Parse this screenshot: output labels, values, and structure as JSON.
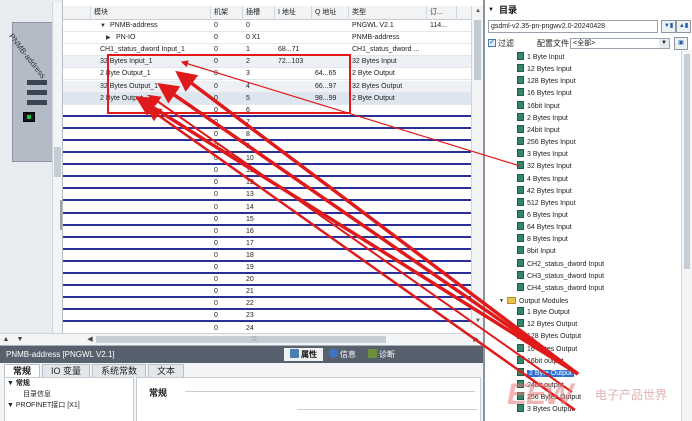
{
  "device_view": {
    "device_label": "PNMB-address"
  },
  "table": {
    "headers": [
      "",
      "模块",
      "机架",
      "插槽",
      "I 地址",
      "Q 地址",
      "类型",
      "订..."
    ],
    "rows": [
      {
        "indent": 1,
        "arrow": "▼",
        "module": "PNMB-address",
        "rack": "0",
        "slot": "0",
        "i_addr": "",
        "q_addr": "",
        "type": "PNGWL V2.1",
        "order": "114..."
      },
      {
        "indent": 2,
        "arrow": "▶",
        "module": "PN-IO",
        "rack": "0",
        "slot": "0 X1",
        "i_addr": "",
        "q_addr": "",
        "type": "PNMB-address",
        "order": ""
      },
      {
        "indent": 1,
        "arrow": "",
        "module": "CH1_status_dword Input_1",
        "rack": "0",
        "slot": "1",
        "i_addr": "68...71",
        "q_addr": "",
        "type": "CH1_status_dword ...",
        "order": ""
      },
      {
        "indent": 1,
        "arrow": "",
        "module": "32 Bytes Input_1",
        "rack": "0",
        "slot": "2",
        "i_addr": "72...103",
        "q_addr": "",
        "type": "32 Bytes Input",
        "order": ""
      },
      {
        "indent": 1,
        "arrow": "",
        "module": "2 Byte Output_1",
        "rack": "0",
        "slot": "3",
        "i_addr": "",
        "q_addr": "64...65",
        "type": "2 Byte Output",
        "order": ""
      },
      {
        "indent": 1,
        "arrow": "",
        "module": "32 Bytes Output_1",
        "rack": "0",
        "slot": "4",
        "i_addr": "",
        "q_addr": "66...97",
        "type": "32 Bytes Output",
        "order": ""
      },
      {
        "indent": 1,
        "arrow": "",
        "module": "2 Byte Output_2",
        "rack": "0",
        "slot": "5",
        "i_addr": "",
        "q_addr": "98...99",
        "type": "2 Byte Output",
        "order": ""
      },
      {
        "module": "",
        "rack": "0",
        "slot": "6"
      },
      {
        "module": "",
        "rack": "0",
        "slot": "7"
      },
      {
        "module": "",
        "rack": "0",
        "slot": "8"
      },
      {
        "module": "",
        "rack": "0",
        "slot": "9"
      },
      {
        "module": "",
        "rack": "0",
        "slot": "10"
      },
      {
        "module": "",
        "rack": "0",
        "slot": "11"
      },
      {
        "module": "",
        "rack": "0",
        "slot": "12"
      },
      {
        "module": "",
        "rack": "0",
        "slot": "13"
      },
      {
        "module": "",
        "rack": "0",
        "slot": "14"
      },
      {
        "module": "",
        "rack": "0",
        "slot": "15"
      },
      {
        "module": "",
        "rack": "0",
        "slot": "16"
      },
      {
        "module": "",
        "rack": "0",
        "slot": "17"
      },
      {
        "module": "",
        "rack": "0",
        "slot": "18"
      },
      {
        "module": "",
        "rack": "0",
        "slot": "19"
      },
      {
        "module": "",
        "rack": "0",
        "slot": "20"
      },
      {
        "module": "",
        "rack": "0",
        "slot": "21"
      },
      {
        "module": "",
        "rack": "0",
        "slot": "22"
      },
      {
        "module": "",
        "rack": "0",
        "slot": "23"
      },
      {
        "module": "",
        "rack": "0",
        "slot": "24"
      }
    ]
  },
  "inspector": {
    "title": "PNMB-address [PNGWL V2.1]",
    "prop_tabs": [
      {
        "label": "属性",
        "icon": "properties-icon"
      },
      {
        "label": "信息",
        "icon": "info-icon"
      },
      {
        "label": "诊断",
        "icon": "diagnostics-icon"
      }
    ],
    "tabs": [
      "常规",
      "IO 变量",
      "系统常数",
      "文本"
    ],
    "nav": [
      "▼ 常规",
      "目录信息",
      "▼ PROFINET接口 [X1]"
    ],
    "heading": "常规"
  },
  "catalog": {
    "title": "目录",
    "search_value": "gsdml-v2.35-pn-pngwv2.0-20240428",
    "filter_label": "过滤",
    "profile_label": "配置文件",
    "profile_value": "<全部>",
    "items": [
      {
        "label": "1 Byte Input",
        "depth": 2,
        "kind": "module"
      },
      {
        "label": "12 Bytes Input",
        "depth": 2,
        "kind": "module"
      },
      {
        "label": "128 Bytes Input",
        "depth": 2,
        "kind": "module"
      },
      {
        "label": "16 Bytes Input",
        "depth": 2,
        "kind": "module"
      },
      {
        "label": "16bit Input",
        "depth": 2,
        "kind": "module"
      },
      {
        "label": "2 Bytes Input",
        "depth": 2,
        "kind": "module"
      },
      {
        "label": "24bit Input",
        "depth": 2,
        "kind": "module"
      },
      {
        "label": "256 Bytes Input",
        "depth": 2,
        "kind": "module"
      },
      {
        "label": "3 Bytes Input",
        "depth": 2,
        "kind": "module"
      },
      {
        "label": "32 Bytes Input",
        "depth": 2,
        "kind": "module"
      },
      {
        "label": "4 Bytes Input",
        "depth": 2,
        "kind": "module"
      },
      {
        "label": "42 Bytes Input",
        "depth": 2,
        "kind": "module"
      },
      {
        "label": "512 Bytes Input",
        "depth": 2,
        "kind": "module"
      },
      {
        "label": "6 Bytes Input",
        "depth": 2,
        "kind": "module"
      },
      {
        "label": "64 Bytes Input",
        "depth": 2,
        "kind": "module"
      },
      {
        "label": "8 Bytes Input",
        "depth": 2,
        "kind": "module"
      },
      {
        "label": "8bit Input",
        "depth": 2,
        "kind": "module"
      },
      {
        "label": "CH2_status_dword Input",
        "depth": 2,
        "kind": "module"
      },
      {
        "label": "CH3_status_dword Input",
        "depth": 2,
        "kind": "module"
      },
      {
        "label": "CH4_status_dword Input",
        "depth": 2,
        "kind": "module"
      },
      {
        "label": "Output Modules",
        "depth": 1,
        "kind": "folder"
      },
      {
        "label": "1 Byte Output",
        "depth": 2,
        "kind": "module"
      },
      {
        "label": "12 Bytes Output",
        "depth": 2,
        "kind": "module"
      },
      {
        "label": "128 Bytes Output",
        "depth": 2,
        "kind": "module"
      },
      {
        "label": "16 Bytes Output",
        "depth": 2,
        "kind": "module"
      },
      {
        "label": "16bit output",
        "depth": 2,
        "kind": "module"
      },
      {
        "label": "2 Byte Output",
        "depth": 2,
        "kind": "module",
        "selected": true
      },
      {
        "label": "24bit output",
        "depth": 2,
        "kind": "module"
      },
      {
        "label": "256 Bytes Output",
        "depth": 2,
        "kind": "module"
      },
      {
        "label": "3 Bytes Output",
        "depth": 2,
        "kind": "module"
      }
    ]
  },
  "watermark": {
    "logo": "EEW",
    "text": "电子产品世界"
  },
  "colors": {
    "annotation_red": "#e01a1a",
    "row_divider_blue": "#2a2f9a",
    "selection_blue": "#2f6fd0",
    "titlebar_gray": "#57616d"
  }
}
